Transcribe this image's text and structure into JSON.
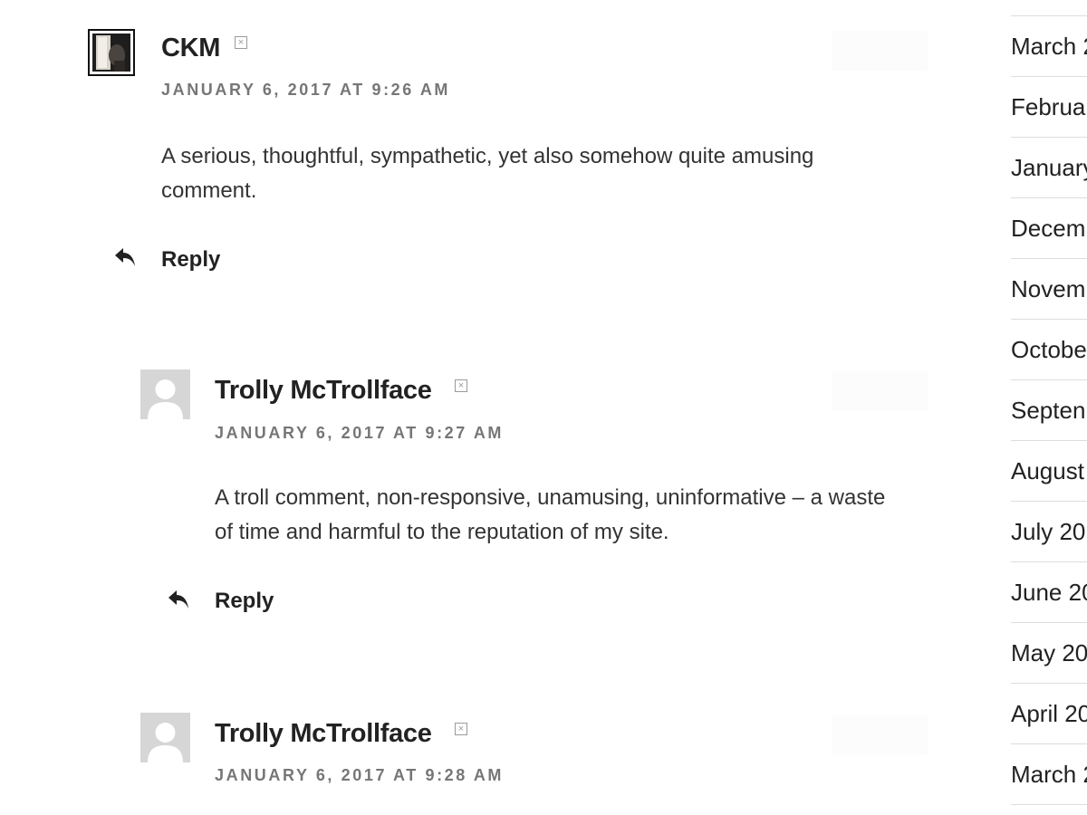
{
  "comments": [
    {
      "author": "CKM",
      "date": "JANUARY 6, 2017 AT 9:26 AM",
      "text": "A serious, thoughtful, sympathetic, yet also somehow quite amusing comment.",
      "reply_label": "Reply",
      "avatar_type": "photo"
    },
    {
      "author": "Trolly McTrollface",
      "date": "JANUARY 6, 2017 AT 9:27 AM",
      "text": "A troll comment, non-responsive, unamusing, uninformative – a waste of time and harmful to the reputation of my site.",
      "reply_label": "Reply",
      "avatar_type": "default"
    },
    {
      "author": "Trolly McTrollface",
      "date": "JANUARY 6, 2017 AT 9:28 AM",
      "avatar_type": "default"
    }
  ],
  "icons": {
    "reply": "reply-arrow-icon",
    "broken_image": "broken-image-icon",
    "avatar_default": "default-avatar-icon"
  },
  "archive": {
    "items": [
      "March 2",
      "Februa",
      "January",
      "Decem",
      "Novem",
      "Octobe",
      "Septen",
      "August",
      "July 20",
      "June 20",
      "May 20",
      "April 20",
      "March 2"
    ]
  },
  "colors": {
    "text": "#222222",
    "meta": "#767676",
    "divider": "#dddddd",
    "avatar_default": "#d6d6d6"
  }
}
